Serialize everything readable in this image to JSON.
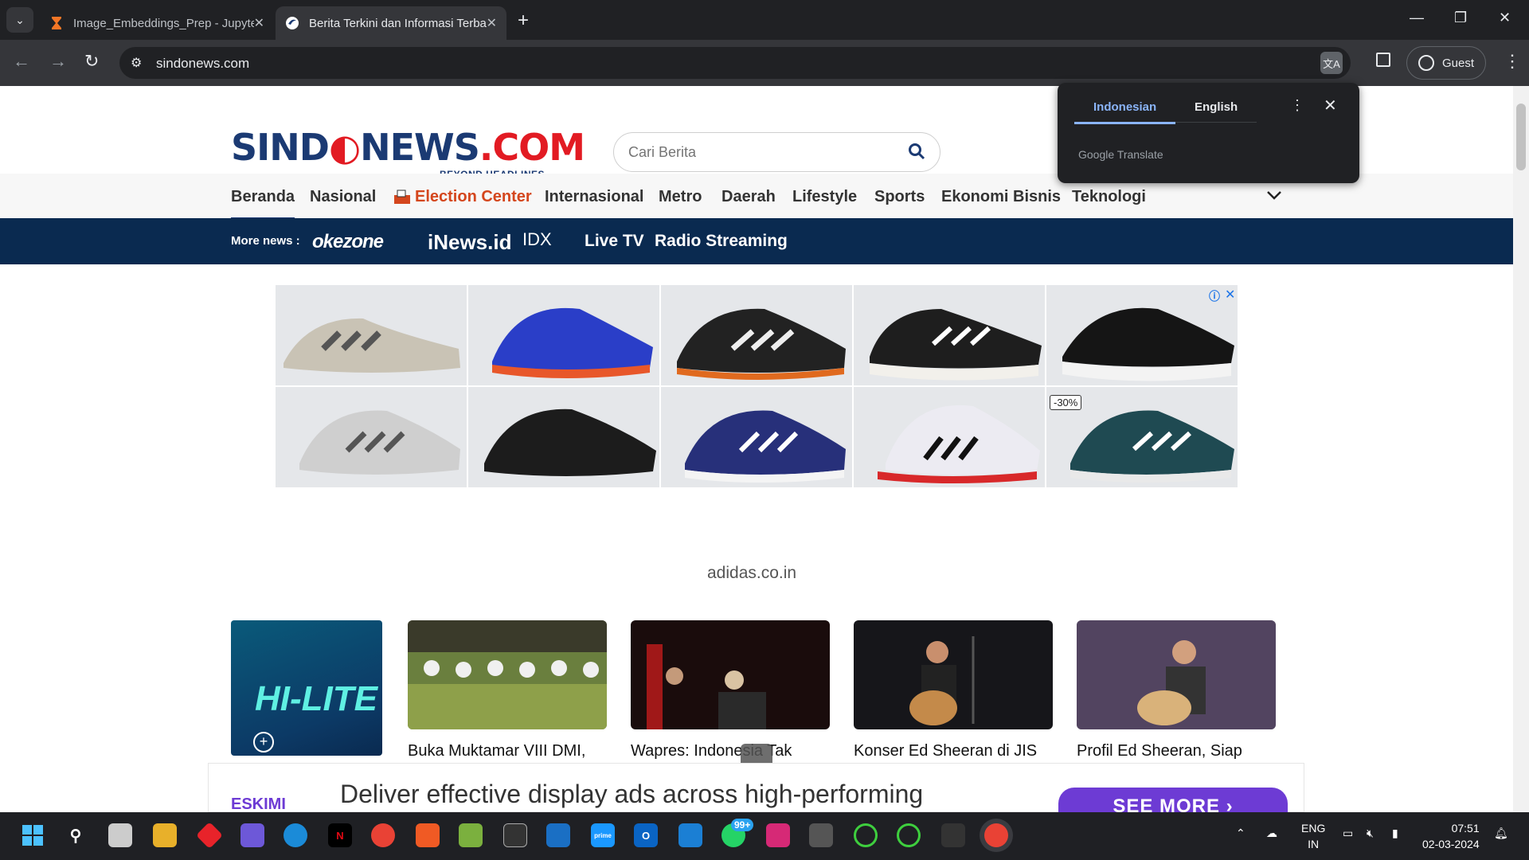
{
  "browser": {
    "tabs": [
      {
        "title": "Image_Embeddings_Prep - Jupyter",
        "active": false
      },
      {
        "title": "Berita Terkini dan Informasi Terbaru",
        "active": true
      }
    ],
    "url": "sindonews.com",
    "profile": "Guest"
  },
  "translate_popup": {
    "lang_source": "Indonesian",
    "lang_target": "English",
    "provider": "Google Translate"
  },
  "site": {
    "logo_text_left": "SIND",
    "logo_text_mid": "NEWS",
    "logo_text_com": ".COM",
    "tagline": "BEYOND HEADLINES",
    "search_placeholder": "Cari Berita",
    "nav": [
      "Beranda",
      "Nasional",
      "Election Center",
      "Internasional",
      "Metro",
      "Daerah",
      "Lifestyle",
      "Sports",
      "Ekonomi Bisnis",
      "Teknologi"
    ],
    "more_news_label": "More news :",
    "partners": {
      "okezone": "okezone",
      "inews": "iNews.id",
      "idx": "IDX"
    },
    "more_links": [
      "Live TV",
      "Radio Streaming"
    ]
  },
  "ad": {
    "domain": "adidas.co.in",
    "discount": "-30%"
  },
  "hilite": {
    "title": "HI-LITE"
  },
  "news": [
    {
      "title": "Buka Muktamar VIII DMI,"
    },
    {
      "title": "Wapres: Indonesia Tak"
    },
    {
      "title": "Konser Ed Sheeran di JIS"
    },
    {
      "title": "Profil Ed Sheeran, Siap"
    }
  ],
  "bottom_ad": {
    "brand": "ESKIMI",
    "message": "Deliver effective display ads across high-performing",
    "cta": "SEE MORE"
  },
  "taskbar": {
    "badge": "99+",
    "lang": "ENG",
    "region": "IN",
    "time": "07:51",
    "date": "02-03-2024"
  },
  "colors": {
    "brand": "#1b3a73",
    "accent": "#e21b23",
    "election": "#d4461d",
    "morebar": "#0a2a50"
  }
}
